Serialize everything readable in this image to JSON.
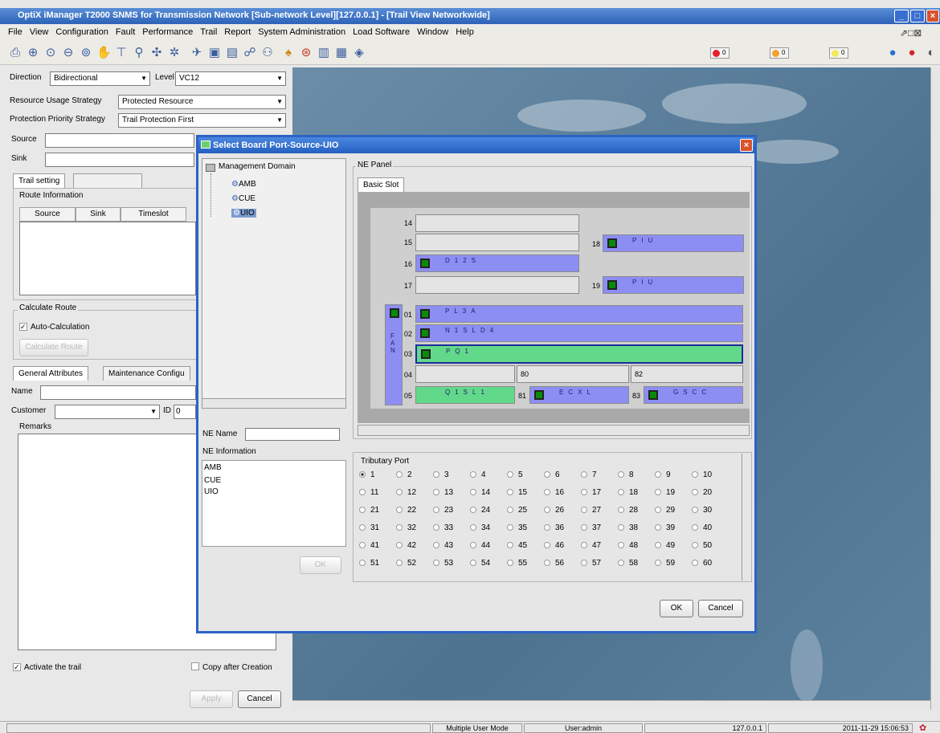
{
  "window": {
    "title": "OptiX iManager T2000 SNMS for Transmission Network [Sub-network Level][127.0.0.1] - [Trail View Networkwide]"
  },
  "menu": [
    "File",
    "View",
    "Configuration",
    "Fault",
    "Performance",
    "Trail",
    "Report",
    "System Administration",
    "Load Software",
    "Window",
    "Help"
  ],
  "alarms": [
    {
      "color": "#e8202a",
      "count": "0"
    },
    {
      "color": "#f2a22a",
      "count": "0"
    },
    {
      "color": "#f3e85a",
      "count": "0"
    }
  ],
  "left": {
    "direction_label": "Direction",
    "direction_value": "Bidirectional",
    "level_label": "Level",
    "level_value": "VC12",
    "resource_label": "Resource Usage Strategy",
    "resource_value": "Protected Resource",
    "protection_label": "Protection Priority Strategy",
    "protection_value": "Trail Protection First",
    "source_label": "Source",
    "sink_label": "Sink",
    "tab_trail": "Trail setting",
    "route_info": "Route Information",
    "cols": [
      "Source",
      "Sink",
      "Timeslot"
    ],
    "calc_route": "Calculate Route",
    "auto_calc": "Auto-Calculation",
    "calc_button": "Calculate Route",
    "tab_general": "General Attributes",
    "tab_maint": "Maintenance Configu",
    "name_label": "Name",
    "customer_label": "Customer",
    "id_label": "ID",
    "id_value": "0",
    "remarks_label": "Remarks",
    "activate": "Activate the trail",
    "copy_after": "Copy after Creation",
    "apply": "Apply",
    "cancel": "Cancel"
  },
  "status": {
    "mode": "Multiple User Mode",
    "user": "User:admin",
    "ip": "127.0.0.1",
    "time": "2011-11-29 15:06:53"
  },
  "dialog": {
    "title": "Select Board Port-Source-UIO",
    "tree_root": "Management Domain",
    "tree_items": [
      "AMB",
      "CUE",
      "UIO"
    ],
    "ne_name_label": "NE Name",
    "ne_info_label": "NE Information",
    "ne_info_items": [
      "AMB",
      "CUE",
      "UIO"
    ],
    "ok_small": "OK",
    "ne_panel": "NE Panel",
    "basic_slot": "Basic Slot",
    "fan": "FAN",
    "slot_nums": {
      "s14": "14",
      "s15": "15",
      "s16": "16",
      "s17": "17",
      "s18": "18",
      "s19": "19",
      "s01": "01",
      "s02": "02",
      "s03": "03",
      "s04": "04",
      "s05": "05",
      "s80": "80",
      "s81": "81",
      "s82": "82",
      "s83": "83"
    },
    "boards": {
      "d12s": "D12S",
      "piu18": "PIU",
      "piu19": "PIU",
      "pl3a": "PL3A",
      "n1sld4": "N1SLD4",
      "pq1": "PQ1",
      "q1sl1": "Q1SL1",
      "ecxl": "ECXL",
      "gscc": "GSCC"
    },
    "tributary_label": "Tributary Port",
    "ports": [
      "1",
      "2",
      "3",
      "4",
      "5",
      "6",
      "7",
      "8",
      "9",
      "10",
      "11",
      "12",
      "13",
      "14",
      "15",
      "16",
      "17",
      "18",
      "19",
      "20",
      "21",
      "22",
      "23",
      "24",
      "25",
      "26",
      "27",
      "28",
      "29",
      "30",
      "31",
      "32",
      "33",
      "34",
      "35",
      "36",
      "37",
      "38",
      "39",
      "40",
      "41",
      "42",
      "43",
      "44",
      "45",
      "46",
      "47",
      "48",
      "49",
      "50",
      "51",
      "52",
      "53",
      "54",
      "55",
      "56",
      "57",
      "58",
      "59",
      "60"
    ],
    "selected_port": "1",
    "ok": "OK",
    "cancel": "Cancel"
  }
}
